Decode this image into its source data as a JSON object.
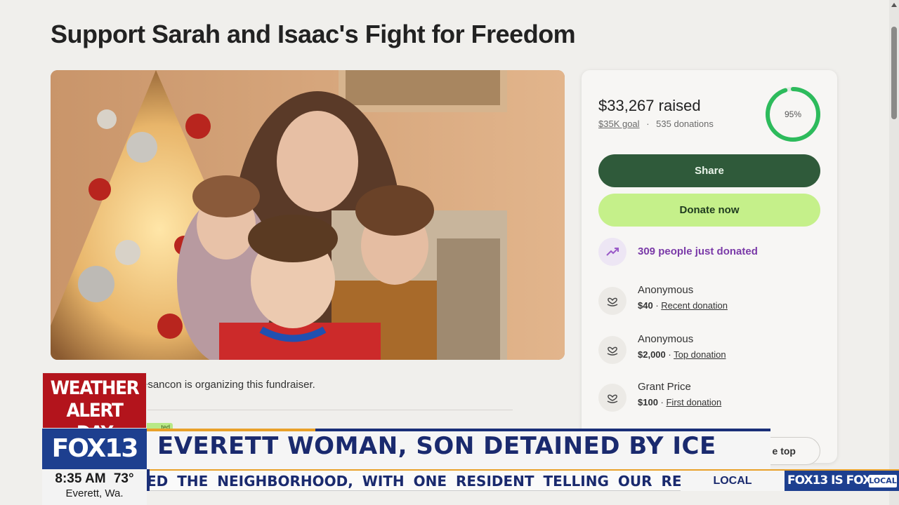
{
  "page": {
    "title": "Support Sarah and Isaac's Fight for Freedom",
    "organizer_text": "esancon is organizing this fundraiser.",
    "tag_fragment": "ted"
  },
  "donation_card": {
    "raised": "$33,267 raised",
    "goal": "$35K goal",
    "separator": "·",
    "donations": "535 donations",
    "progress_label": "95%",
    "progress_fraction": 0.95,
    "share_label": "Share",
    "donate_label": "Donate now",
    "recent_activity": "309 people just donated",
    "donors": [
      {
        "name": "Anonymous",
        "amount": "$40",
        "type": "Recent donation"
      },
      {
        "name": "Anonymous",
        "amount": "$2,000",
        "type": "Top donation"
      },
      {
        "name": "Grant Price",
        "amount": "$100",
        "type": "First donation"
      }
    ],
    "top_pill_fragment": "e top"
  },
  "broadcast": {
    "alert_line1": "WEATHER",
    "alert_line2": "ALERT DAY",
    "station_logo": "FOX13",
    "headline": "EVERETT WOMAN, SON DETAINED BY ICE",
    "time": "8:35 AM",
    "temperature": "73°",
    "location": "Everett, Wa.",
    "ticker": "ED THE NEIGHBORHOOD, WITH ONE RESIDENT TELLING OUR REPORTE",
    "section": "LOCAL",
    "brand": "FOX13 IS FOX",
    "brand_tag": "LOCAL"
  },
  "colors": {
    "share_button": "#2f5a3a",
    "donate_button": "#c5f08a",
    "progress_ring": "#2dbb5c",
    "activity_purple": "#7a3aa8",
    "alert_red": "#b3141c",
    "fox_blue": "#1d3f8f"
  },
  "icons": {
    "trend": "trending-up-icon",
    "donor": "heart-hand-icon"
  }
}
